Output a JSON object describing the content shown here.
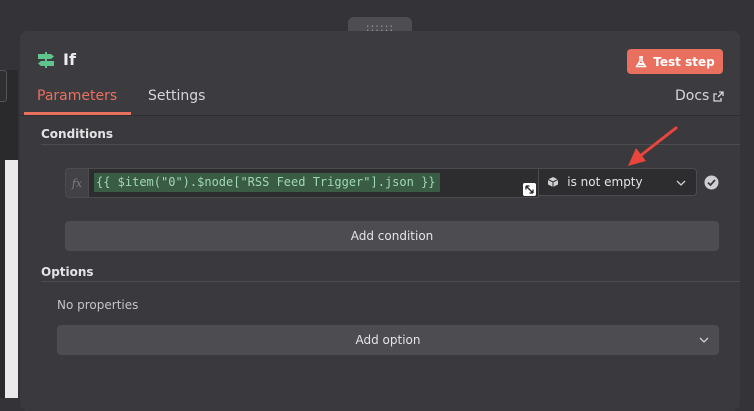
{
  "node": {
    "title": "If",
    "icon": "signpost-icon"
  },
  "header": {
    "test_step_label": "Test step",
    "docs_label": "Docs"
  },
  "tabs": [
    {
      "label": "Parameters",
      "active": true
    },
    {
      "label": "Settings",
      "active": false
    }
  ],
  "conditions": {
    "section_label": "Conditions",
    "fx_label": "fx",
    "expression": "{{ $item(\"0\").$node[\"RSS Feed Trigger\"].json }}",
    "operator": "is not empty",
    "add_condition_label": "Add condition"
  },
  "options": {
    "section_label": "Options",
    "empty_text": "No properties",
    "add_option_label": "Add option"
  },
  "colors": {
    "accent": "#e9705f",
    "expression_bg": "#3a5b44",
    "expression_text": "#9fd8b3",
    "panel": "#3c3c40"
  }
}
